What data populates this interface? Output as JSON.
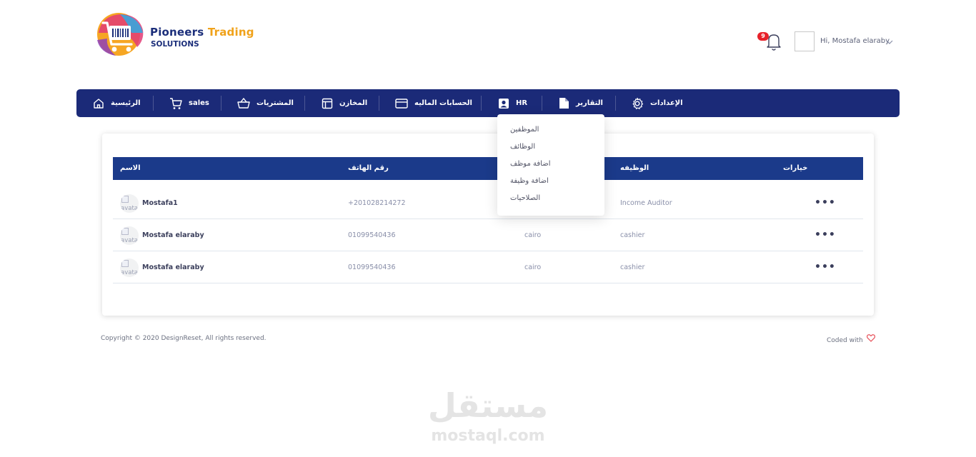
{
  "brand": {
    "name_part1": "Pioneers",
    "name_part2": "Trading",
    "subtitle": "SOLUTIONS",
    "colors": {
      "primary": "#1b2e7a",
      "accent": "#f0a21a"
    }
  },
  "header": {
    "notification_count": "9",
    "greeting": "Hi, Mostafa elaraby",
    "icons": {
      "notifications": "bell-icon",
      "user_menu": "chevron-down-icon"
    }
  },
  "nav": {
    "items": [
      {
        "label": "الرئيسية",
        "icon": "home-icon"
      },
      {
        "label": "sales",
        "icon": "cart-icon"
      },
      {
        "label": "المشتريات",
        "icon": "basket-icon"
      },
      {
        "label": "المخازن",
        "icon": "layout-icon"
      },
      {
        "label": "الحسابات الماليه",
        "icon": "credit-card-icon"
      },
      {
        "label": "HR",
        "icon": "id-card-icon"
      },
      {
        "label": "التقارير",
        "icon": "file-icon"
      },
      {
        "label": "الإعدادات",
        "icon": "gear-icon"
      }
    ],
    "color": "#1b2a78"
  },
  "hr_dropdown": {
    "items": [
      "الموظفين",
      "الوظائف",
      "اضافة موظف",
      "اضافة وظيفة",
      "الصلاحيات"
    ]
  },
  "table": {
    "headers": {
      "name": "الاسم",
      "phone": "رقم الهاتف",
      "job": "الوظيفه",
      "options": "خيارات"
    },
    "rows": [
      {
        "name": "Mostafa1",
        "phone": "+201028214272",
        "address": "",
        "job": "Income Auditor",
        "avatar_alt": "avatar"
      },
      {
        "name": "Mostafa elaraby",
        "phone": "01099540436",
        "address": "cairo",
        "job": "cashier",
        "avatar_alt": "avatar"
      },
      {
        "name": "Mostafa elaraby",
        "phone": "01099540436",
        "address": "cairo",
        "job": "cashier",
        "avatar_alt": "avatar"
      }
    ],
    "header_color": "#1b3a8a",
    "options_glyph": "•••"
  },
  "footer": {
    "copyright": "Copyright © 2020 DesignReset, All rights reserved.",
    "coded_with": "Coded with"
  },
  "watermark": {
    "arabic": "مستقل",
    "latin": "mostaql.com"
  }
}
